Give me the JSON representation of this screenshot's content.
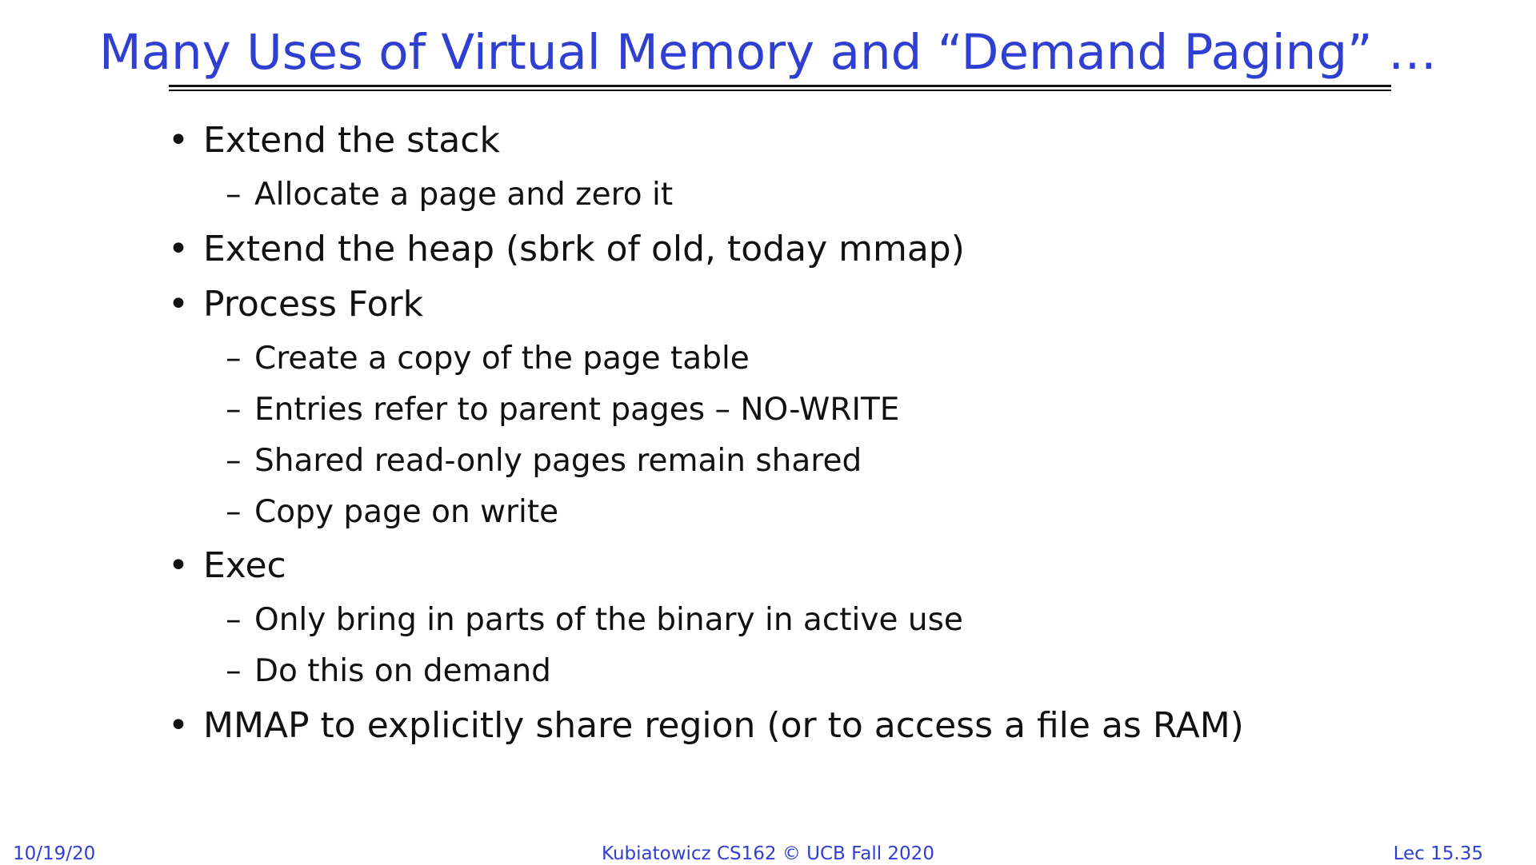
{
  "slide": {
    "title": "Many Uses of Virtual Memory and “Demand Paging” …",
    "bullet_marker": "•",
    "sub_marker": "–",
    "items": [
      {
        "text": "Extend the stack"
      },
      {
        "text": "Allocate a page and zero it"
      },
      {
        "text": "Extend the heap (sbrk of old, today mmap)"
      },
      {
        "text": "Process Fork"
      },
      {
        "text": "Create a copy of the page table"
      },
      {
        "text": "Entries refer to parent pages – NO-WRITE"
      },
      {
        "text": "Shared read-only pages remain shared"
      },
      {
        "text": "Copy page on write"
      },
      {
        "text": "Exec"
      },
      {
        "text": "Only bring in parts of the binary in active use"
      },
      {
        "text": "Do this on demand"
      },
      {
        "text": "MMAP to explicitly share region (or to access a file as RAM)"
      }
    ]
  },
  "footer": {
    "date": "10/19/20",
    "course": "Kubiatowicz CS162 © UCB Fall 2020",
    "lecture": "Lec 15.35"
  },
  "colors": {
    "title": "#2f3fd2",
    "body_text": "#111111",
    "footer": "#2f3fd2",
    "background": "#ffffff"
  }
}
